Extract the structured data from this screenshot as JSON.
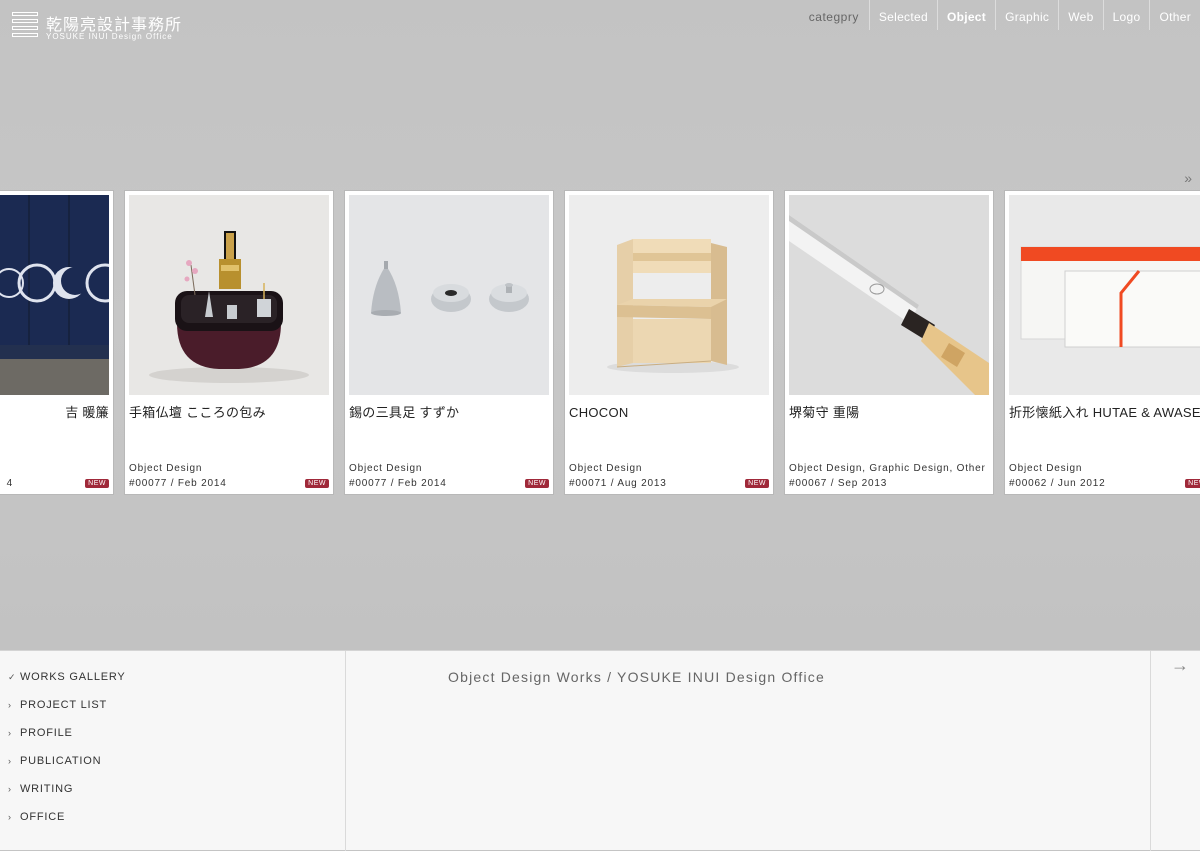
{
  "logo": {
    "jp": "乾陽亮設計事務所",
    "en": "YOSUKE INUI Design Office"
  },
  "category_nav": {
    "label": "categpry",
    "items": [
      {
        "label": "Selected",
        "active": false
      },
      {
        "label": "Object",
        "active": true
      },
      {
        "label": "Graphic",
        "active": false
      },
      {
        "label": "Web",
        "active": false
      },
      {
        "label": "Logo",
        "active": false
      },
      {
        "label": "Other",
        "active": false
      }
    ]
  },
  "carousel": {
    "next_label": "»",
    "cards": [
      {
        "title": "吉 暖簾",
        "category": "",
        "meta": "4",
        "new": "NEW"
      },
      {
        "title": "手箱仏壇 こころの包み",
        "category": "Object Design",
        "meta": "#00077 / Feb 2014",
        "new": "NEW"
      },
      {
        "title": "錫の三具足 すずか",
        "category": "Object Design",
        "meta": "#00077 / Feb 2014",
        "new": "NEW"
      },
      {
        "title": "CHOCON",
        "category": "Object Design",
        "meta": "#00071 / Aug 2013",
        "new": "NEW"
      },
      {
        "title": "堺菊守 重陽",
        "category": "Object Design, Graphic Design, Other",
        "meta": "#00067 / Sep 2013",
        "new": ""
      },
      {
        "title": "折形懐紙入れ HUTAE & AWASE",
        "category": "Object Design",
        "meta": "#00062 / Jun 2012",
        "new": "NEW"
      }
    ]
  },
  "side_nav": {
    "items": [
      {
        "label": "WORKS GALLERY",
        "mark": "✓"
      },
      {
        "label": "PROJECT LIST",
        "mark": "›"
      },
      {
        "label": "PROFILE",
        "mark": "›"
      },
      {
        "label": "PUBLICATION",
        "mark": "›"
      },
      {
        "label": "WRITING",
        "mark": "›"
      },
      {
        "label": "OFFICE",
        "mark": "›"
      }
    ]
  },
  "page_heading": "Object Design Works / YOSUKE INUI Design Office",
  "arrow_label": "→",
  "colors": {
    "new_badge": "#a0293a",
    "background": "#c4c4c4",
    "bottom_panel": "#f7f7f7"
  }
}
